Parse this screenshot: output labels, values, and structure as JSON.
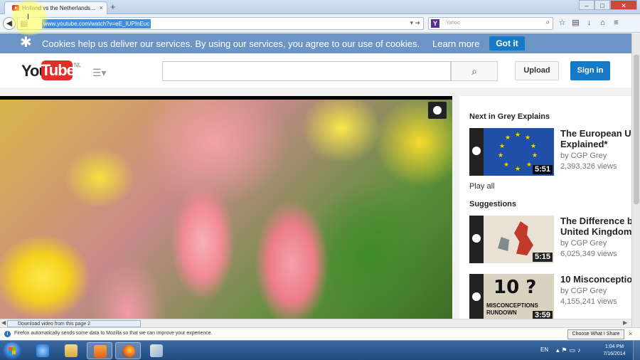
{
  "browser": {
    "tab_title": "Holland vs the Netherlands...",
    "tab_close": "×",
    "new_tab": "+",
    "url": "www.youtube.com/watch?v=eE_IUPInEuc",
    "search_engine_icon": "Y",
    "search_placeholder": "Yahoo",
    "window_buttons": [
      "–",
      "□",
      "✕"
    ]
  },
  "cookie_banner": {
    "message": "Cookies help us deliver our services. By using our services, you agree to our use of cookies.",
    "learn_more": "Learn more",
    "got_it": "Got it"
  },
  "youtube_header": {
    "logo_you": "You",
    "logo_tube": "Tube",
    "region": "NL",
    "search_value": "",
    "upload_label": "Upload",
    "signin_label": "Sign in"
  },
  "sidebar": {
    "next_heading": "Next in Grey Explains",
    "play_all": "Play all",
    "suggestions_heading": "Suggestions",
    "items": [
      {
        "title_line1": "The European U",
        "title_line2": "Explained*",
        "by": "by CGP Grey",
        "views": "2,393,326 views",
        "duration": "5:51"
      },
      {
        "title_line1": "The Difference b",
        "title_line2": "United Kingdom",
        "by": "by CGP Grey",
        "views": "6,025,349 views",
        "duration": "5:15"
      },
      {
        "title_line1": "10 Misconceptio",
        "title_line2": "",
        "by": "by CGP Grey",
        "views": "4,155,241 views",
        "duration": "3:59",
        "thumb_big": "10 ?",
        "thumb_sub": "MISCONCEPTIONS RUNDOWN"
      }
    ]
  },
  "download_bar": {
    "text": "Download video from this page",
    "count": "2"
  },
  "notification": {
    "text": "Firefox automatically sends some data to Mozilla so that we can improve your experience.",
    "share_button": "Choose What I Share",
    "close": "×"
  },
  "taskbar": {
    "language": "EN",
    "time": "1:04 PM",
    "date": "7/16/2014"
  },
  "colors": {
    "youtube_red": "#e52d27",
    "cookie_banner": "#6c95c6",
    "signin_blue": "#167ac6"
  }
}
